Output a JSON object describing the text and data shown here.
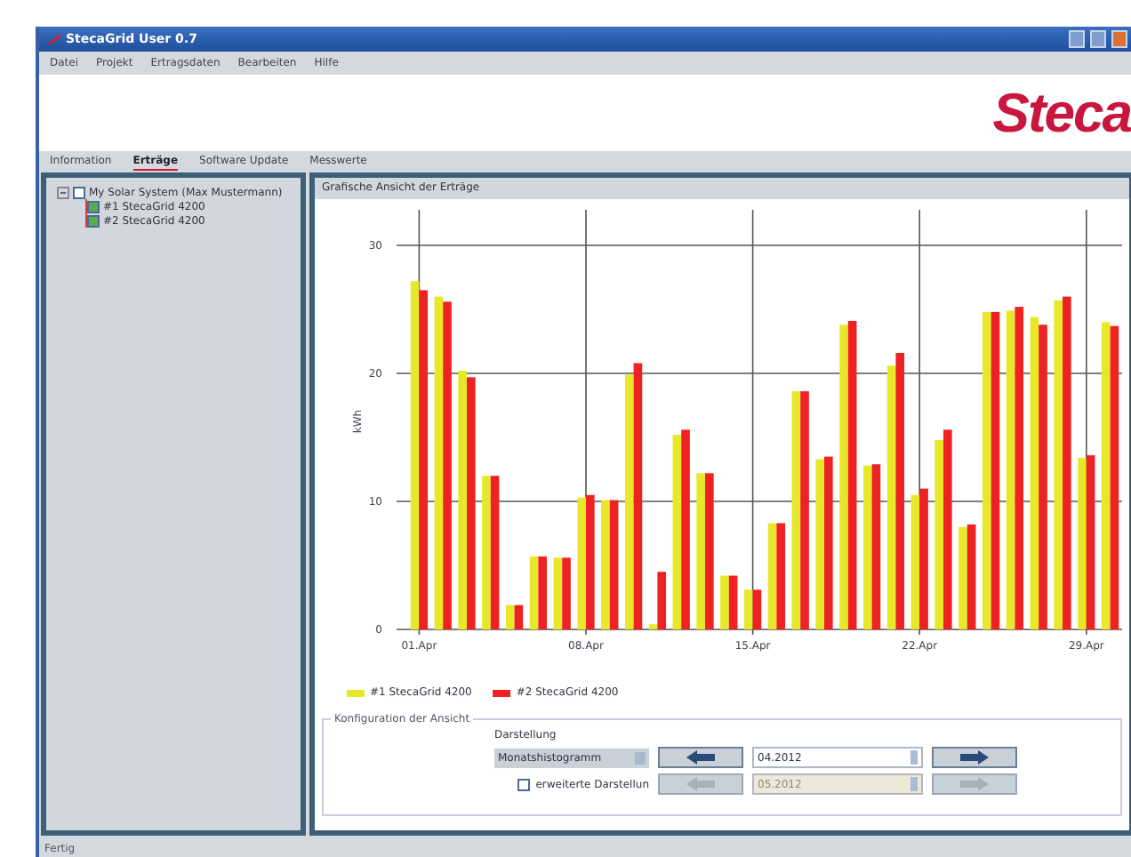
{
  "window": {
    "title": "StecaGrid User 0.7"
  },
  "menu": [
    "Datei",
    "Projekt",
    "Ertragsdaten",
    "Bearbeiten",
    "Hilfe"
  ],
  "logo": "Steca",
  "tabs": [
    {
      "label": "Information",
      "selected": false
    },
    {
      "label": "Erträge",
      "selected": true
    },
    {
      "label": "Software Update",
      "selected": false
    },
    {
      "label": "Messwerte",
      "selected": false
    }
  ],
  "tree": [
    {
      "label": "My Solar System (Max Mustermann)",
      "checked": false,
      "expanded": true,
      "children": [
        {
          "label": "#1 StecaGrid 4200",
          "checked": true
        },
        {
          "label": "#2 StecaGrid 4200",
          "checked": true
        }
      ]
    }
  ],
  "chart_panel": {
    "title": "Grafische Ansicht der Erträge",
    "chart_data": {
      "type": "bar",
      "ylabel": "kWh",
      "categories": [
        "01.Apr",
        null,
        null,
        null,
        null,
        null,
        null,
        "08.Apr",
        null,
        null,
        null,
        null,
        null,
        null,
        "15.Apr",
        null,
        null,
        null,
        null,
        null,
        null,
        "22.Apr",
        null,
        null,
        null,
        null,
        null,
        null,
        "29.Apr",
        null
      ],
      "ylim": [
        0,
        32.5
      ],
      "yticks": [
        0,
        10,
        20,
        30
      ],
      "grid": true,
      "series": [
        {
          "name": "#1 StecaGrid 4200",
          "color": "#e8e82a",
          "values": [
            27.2,
            26,
            20.2,
            12,
            1.9,
            5.7,
            5.6,
            10.3,
            10.1,
            19.9,
            0.4,
            15.2,
            12.2,
            4.2,
            3.1,
            8.3,
            18.6,
            13.3,
            23.8,
            12.8,
            20.6,
            10.5,
            14.8,
            8,
            24.8,
            24.9,
            24.4,
            25.7,
            13.4,
            24
          ]
        },
        {
          "name": "#2 StecaGrid 4200",
          "color": "#ee2222",
          "values": [
            26.5,
            25.6,
            19.7,
            12,
            1.9,
            5.7,
            5.6,
            10.5,
            10.1,
            20.8,
            4.5,
            15.6,
            12.2,
            4.2,
            3.1,
            8.3,
            18.6,
            13.5,
            24.1,
            12.9,
            21.6,
            11,
            15.6,
            8.2,
            24.8,
            25.2,
            23.8,
            26,
            13.6,
            23.7
          ]
        }
      ]
    }
  },
  "config": {
    "title": "Konfiguration der Ansicht",
    "label": "Darstellung",
    "mode": "Monatshistogramm",
    "period": "04.2012",
    "extended": {
      "label": "erweiterte Darstellun",
      "checked": false,
      "period": "05.2012"
    }
  },
  "status_bar": "Fertig"
}
